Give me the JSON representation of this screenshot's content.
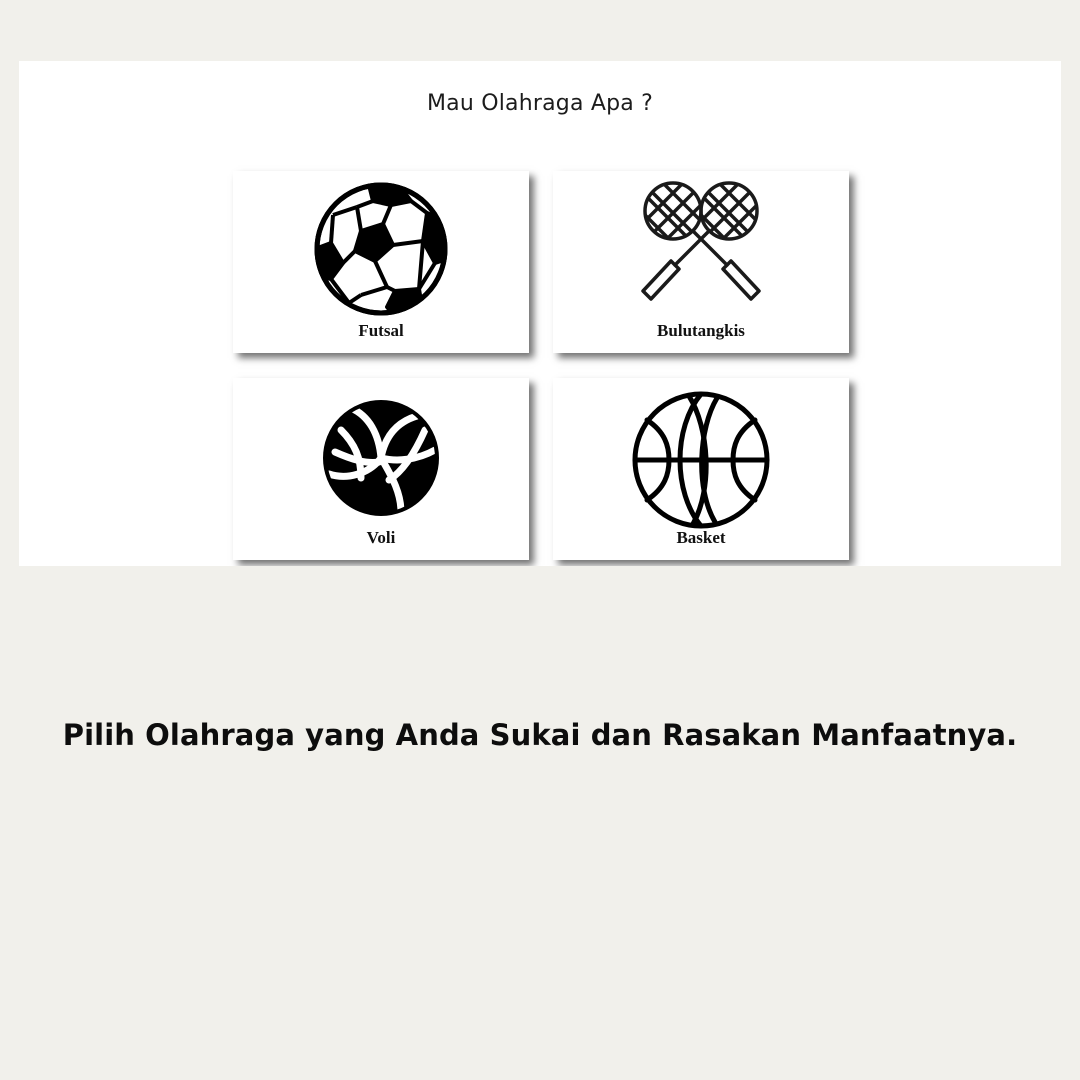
{
  "panel": {
    "heading": "Mau Olahraga Apa ?"
  },
  "cards": [
    {
      "label": "Futsal",
      "icon": "soccer-ball-icon"
    },
    {
      "label": "Bulutangkis",
      "icon": "badminton-rackets-icon"
    },
    {
      "label": "Voli",
      "icon": "volleyball-icon"
    },
    {
      "label": "Basket",
      "icon": "basketball-icon"
    }
  ],
  "caption": "Pilih Olahraga yang Anda Sukai dan Rasakan Manfaatnya.",
  "colors": {
    "page_background": "#f1f0eb",
    "panel_background": "#ffffff",
    "text": "#111111"
  }
}
